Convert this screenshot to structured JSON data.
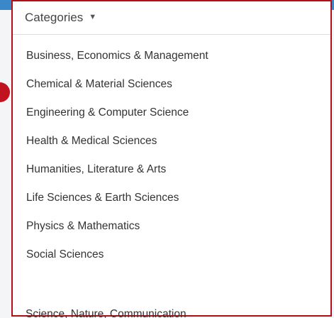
{
  "menu": {
    "header_label": "Categories",
    "caret_icon": "caret-down-icon",
    "items": [
      {
        "label": "Business, Economics & Management"
      },
      {
        "label": "Chemical & Material Sciences"
      },
      {
        "label": "Engineering & Computer Science"
      },
      {
        "label": "Health & Medical Sciences"
      },
      {
        "label": "Humanities, Literature & Arts"
      },
      {
        "label": "Life Sciences & Earth Sciences"
      },
      {
        "label": "Physics & Mathematics"
      },
      {
        "label": "Social Sciences"
      }
    ],
    "partial_next_item": "Science, Nature, Communication"
  },
  "colors": {
    "highlight_border": "#b20e17",
    "badge": "#c1121f",
    "top_strip": "#3a87c9"
  }
}
